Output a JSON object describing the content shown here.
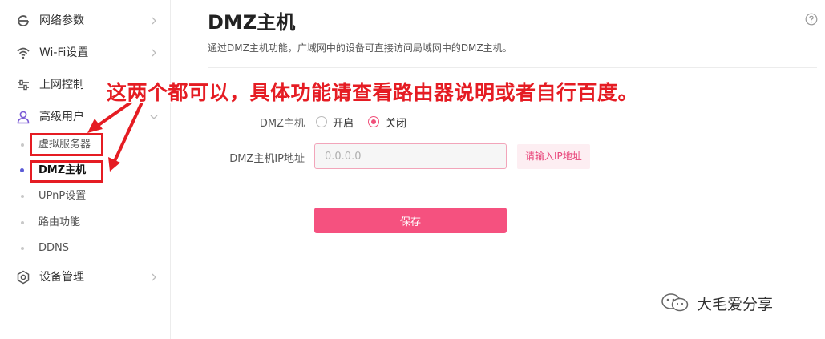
{
  "sidebar": {
    "items": [
      {
        "label": "网络参数",
        "icon": "network-e-icon"
      },
      {
        "label": "Wi-Fi设置",
        "icon": "wifi-icon"
      },
      {
        "label": "上网控制",
        "icon": "sliders-icon"
      },
      {
        "label": "高级用户",
        "icon": "user-icon"
      },
      {
        "label": "设备管理",
        "icon": "gear-icon"
      }
    ],
    "sub_items": [
      {
        "label": "虚拟服务器"
      },
      {
        "label": "DMZ主机"
      },
      {
        "label": "UPnP设置"
      },
      {
        "label": "路由功能"
      },
      {
        "label": "DDNS"
      }
    ]
  },
  "page": {
    "title": "DMZ主机",
    "description": "通过DMZ主机功能，广域网中的设备可直接访问局域网中的DMZ主机。"
  },
  "annotation": "这两个都可以，具体功能请查看路由器说明或者自行百度。",
  "form": {
    "dmz_label": "DMZ主机",
    "option_on": "开启",
    "option_off": "关闭",
    "selected": "关闭",
    "ip_label": "DMZ主机IP地址",
    "ip_placeholder": "0.0.0.0",
    "ip_error": "请输入IP地址",
    "save_label": "保存"
  },
  "watermark": "大毛爱分享",
  "colors": {
    "accent": "#f5517f",
    "annotation": "#e51c23",
    "active_dot": "#5b5bd6"
  }
}
